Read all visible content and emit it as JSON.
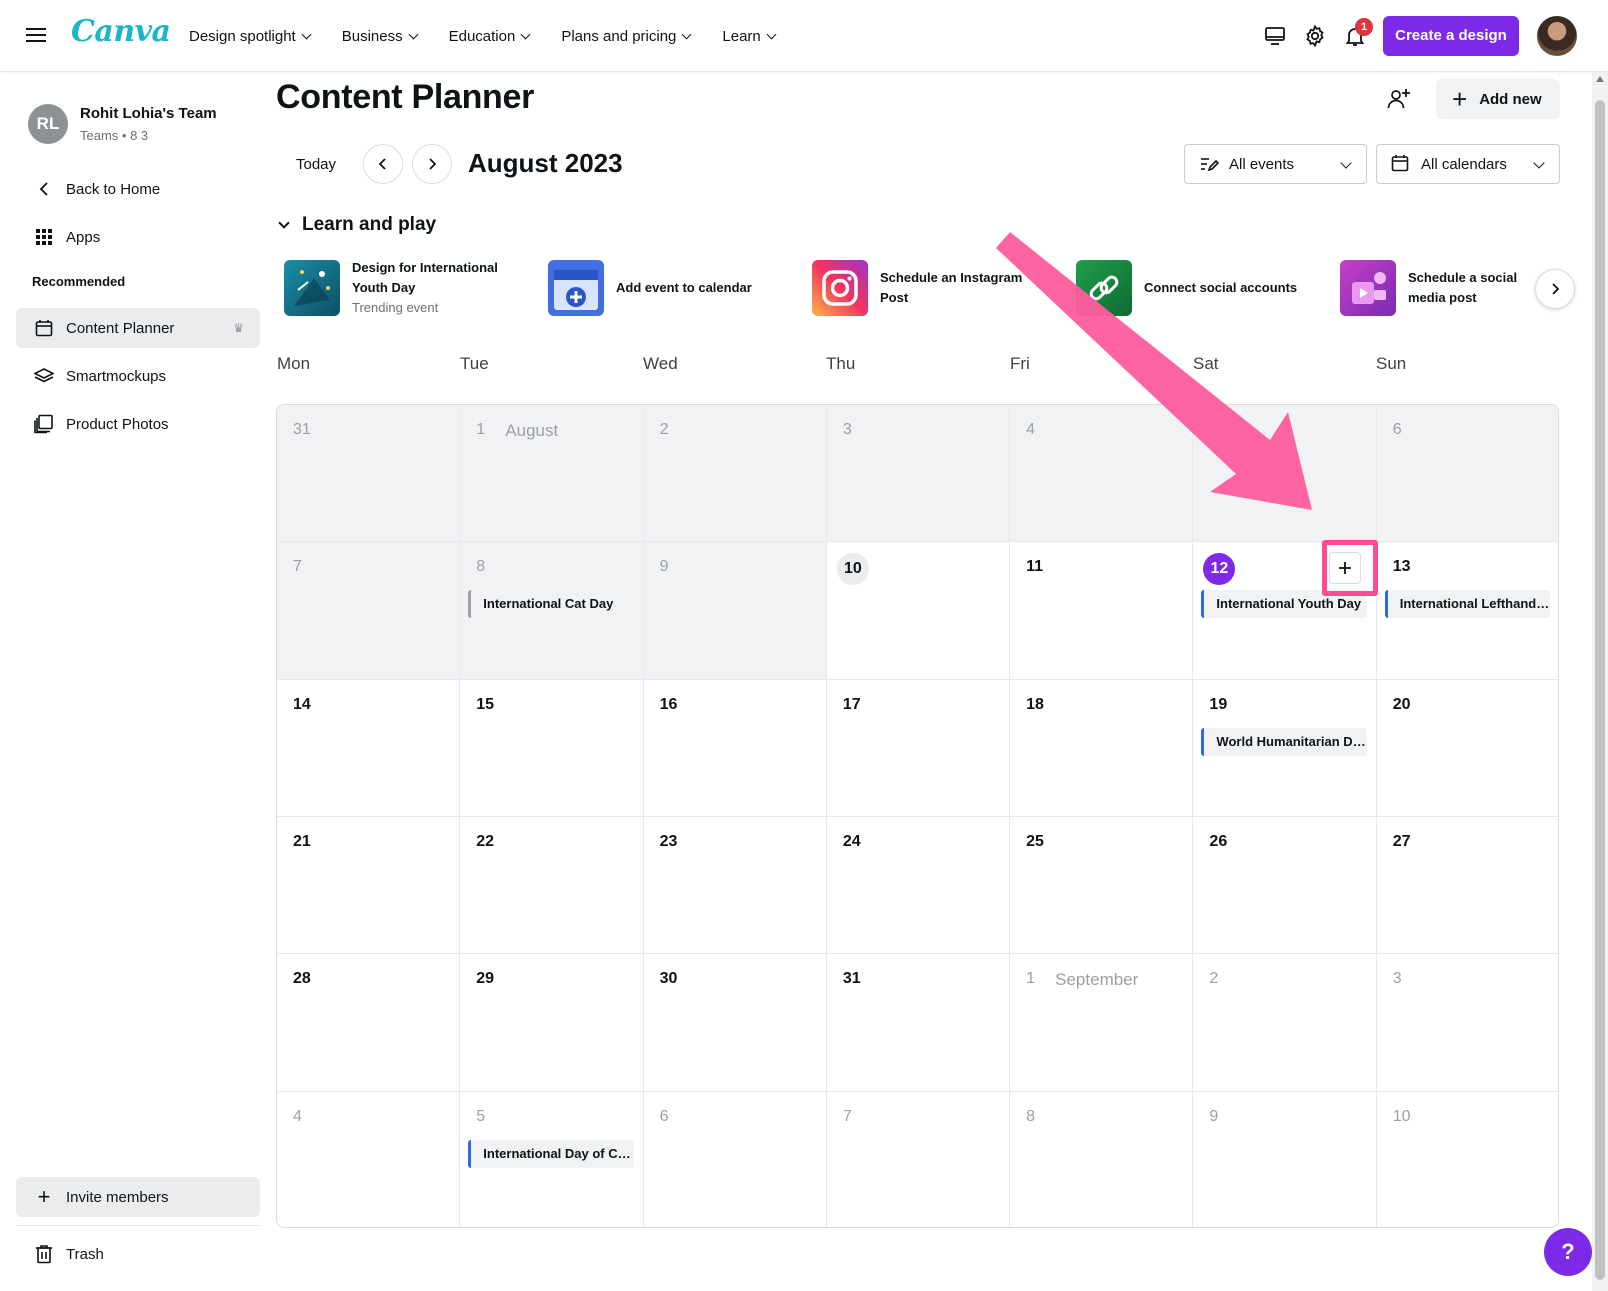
{
  "topbar": {
    "logo": "Canva",
    "nav": [
      {
        "label": "Design spotlight"
      },
      {
        "label": "Business"
      },
      {
        "label": "Education"
      },
      {
        "label": "Plans and pricing"
      },
      {
        "label": "Learn"
      }
    ],
    "notification_count": "1",
    "create_label": "Create a design",
    "icons": [
      "hamburger-icon",
      "desktop-icon",
      "settings-icon",
      "bell-icon",
      "user-avatar"
    ]
  },
  "sidebar": {
    "team": {
      "initials": "RL",
      "name": "Rohit Lohia's Team",
      "sub": "Teams • 8 3"
    },
    "back_label": "Back to Home",
    "apps_label": "Apps",
    "section_label": "Recommended",
    "items": [
      {
        "label": "Content Planner",
        "active": true
      },
      {
        "label": "Smartmockups"
      },
      {
        "label": "Product Photos"
      }
    ],
    "invite_label": "Invite members",
    "trash_label": "Trash"
  },
  "main": {
    "title": "Content Planner",
    "add_new_label": "Add new",
    "today_label": "Today",
    "month_label": "August 2023",
    "filters": {
      "events": "All events",
      "calendars": "All calendars"
    },
    "learn_and_play": {
      "heading": "Learn and play",
      "cards": [
        {
          "title": "Design for International Youth Day",
          "sub": "Trending event"
        },
        {
          "title": "Add event to calendar"
        },
        {
          "title": "Schedule an Instagram Post"
        },
        {
          "title": "Connect social accounts"
        },
        {
          "title": "Schedule a social media post"
        }
      ]
    },
    "weekdays": [
      "Mon",
      "Tue",
      "Wed",
      "Thu",
      "Fri",
      "Sat",
      "Sun"
    ],
    "weeks": [
      [
        {
          "d": "31",
          "past": true
        },
        {
          "d": "1",
          "month": "August",
          "past": true
        },
        {
          "d": "2",
          "past": true
        },
        {
          "d": "3",
          "past": true
        },
        {
          "d": "4",
          "past": true
        },
        {
          "d": "5",
          "past": true
        },
        {
          "d": "6",
          "past": true
        }
      ],
      [
        {
          "d": "7",
          "past": true
        },
        {
          "d": "8",
          "past": true,
          "event": "International Cat Day",
          "event_color": "gray"
        },
        {
          "d": "9",
          "past": true
        },
        {
          "d": "10",
          "today": true
        },
        {
          "d": "11"
        },
        {
          "d": "12",
          "selected": true,
          "event": "International Youth Day",
          "event_color": "blue"
        },
        {
          "d": "13",
          "event": "International Lefthanders Day",
          "event_color": "blue"
        }
      ],
      [
        {
          "d": "14"
        },
        {
          "d": "15"
        },
        {
          "d": "16"
        },
        {
          "d": "17"
        },
        {
          "d": "18"
        },
        {
          "d": "19",
          "event": "World Humanitarian Day",
          "event_color": "blue"
        },
        {
          "d": "20"
        }
      ],
      [
        {
          "d": "21"
        },
        {
          "d": "22"
        },
        {
          "d": "23"
        },
        {
          "d": "24"
        },
        {
          "d": "25"
        },
        {
          "d": "26"
        },
        {
          "d": "27"
        }
      ],
      [
        {
          "d": "28"
        },
        {
          "d": "29"
        },
        {
          "d": "30"
        },
        {
          "d": "31"
        },
        {
          "d": "1",
          "month": "September",
          "muted": true
        },
        {
          "d": "2",
          "muted": true
        },
        {
          "d": "3",
          "muted": true
        }
      ],
      [
        {
          "d": "4",
          "muted": true
        },
        {
          "d": "5",
          "muted": true,
          "event": "International Day of Charity",
          "event_color": "blue"
        },
        {
          "d": "6",
          "muted": true
        },
        {
          "d": "7",
          "muted": true
        },
        {
          "d": "8",
          "muted": true
        },
        {
          "d": "9",
          "muted": true
        },
        {
          "d": "10",
          "muted": true
        }
      ]
    ]
  },
  "help_label": "?",
  "colors": {
    "accent": "#7d2ae8",
    "event_blue": "#2f6bd9",
    "annotation_pink": "#ff4b93"
  }
}
